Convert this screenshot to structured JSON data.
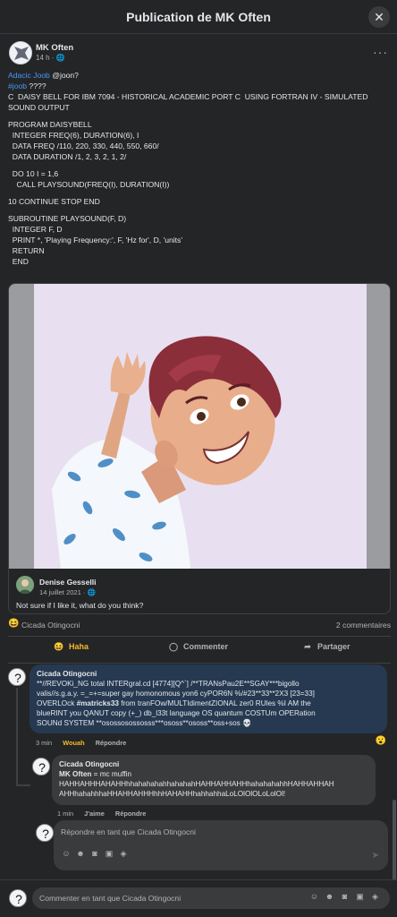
{
  "header": {
    "title": "Publication de MK Often",
    "close_icon": "close-icon"
  },
  "post": {
    "author": "MK Often",
    "time": "14 h ·",
    "lines": [
      {
        "parts": [
          {
            "t": "Adacic Joob",
            "link": true
          },
          {
            "t": " @joon?"
          }
        ]
      },
      {
        "parts": [
          {
            "t": "#joob",
            "link": true
          },
          {
            "t": " ????"
          }
        ]
      },
      {
        "parts": [
          {
            "t": "C  DAISY BELL FOR IBM 7094 - HISTORICAL ACADEMIC PORT C  USING FORTRAN IV - SIMULATED"
          }
        ]
      },
      {
        "parts": [
          {
            "t": "SOUND OUTPUT"
          }
        ]
      },
      {
        "gap": true
      },
      {
        "parts": [
          {
            "t": "PROGRAM DAISYBELL"
          }
        ]
      },
      {
        "parts": [
          {
            "t": "  INTEGER FREQ(6), DURATION(6), I"
          }
        ]
      },
      {
        "parts": [
          {
            "t": "  DATA FREQ /110, 220, 330, 440, 550, 660/"
          }
        ]
      },
      {
        "parts": [
          {
            "t": "  DATA DURATION /1, 2, 3, 2, 1, 2/"
          }
        ]
      },
      {
        "gap": true
      },
      {
        "parts": [
          {
            "t": "  DO 10 I = 1,6"
          }
        ]
      },
      {
        "parts": [
          {
            "t": "    CALL PLAYSOUND(FREQ(I), DURATION(I))"
          }
        ]
      },
      {
        "gap": true
      },
      {
        "parts": [
          {
            "t": "10 CONTINUE STOP END"
          }
        ]
      },
      {
        "gap": true
      },
      {
        "parts": [
          {
            "t": "SUBROUTINE PLAYSOUND(F, D)"
          }
        ]
      },
      {
        "parts": [
          {
            "t": "  INTEGER F, D"
          }
        ]
      },
      {
        "parts": [
          {
            "t": "  PRINT *, 'Playing Frequency:', F, 'Hz for', D, 'units'"
          }
        ]
      },
      {
        "parts": [
          {
            "t": "  RETURN"
          }
        ]
      },
      {
        "parts": [
          {
            "t": "  END"
          }
        ]
      }
    ]
  },
  "shared": {
    "author": "Denise Gesselli",
    "date": "14 juillet 2021 · ",
    "text": "Not sure if I like it, what do you think?"
  },
  "reactions": {
    "emoji": "😆",
    "reactor": "Cicada Otingocni",
    "comments": "2 commentaires"
  },
  "actions": {
    "haha": "Haha",
    "comment": "Commenter",
    "share": "Partager"
  },
  "comments": [
    {
      "author": "Cicada Otingocni",
      "lines": [
        "**//REVOKi_NG total INTERgral.cd [4774][Q^`] /**TRANsPau2E**SGAY***bigollo",
        "valis//s.g.a.y. =_=+=super gay homonomous yon6 cyPOR6N %/#23**33**2X3 [23=33]",
        "OVERLOck ",
        "blueRINT you QANUT copy (+_) db_l33t language OS quantum COSTUm OPERation",
        "SOUNd SYSTEM **osossosossosss***ososs**ososs**oss+sos 💀"
      ],
      "tag": "#matricks33",
      "line3_rest": " from tranFOw/MULTIdimentZIONAL zer0 RUles %I AM the",
      "time": "3 min",
      "reaction": "Wouah",
      "reply": "Répondre",
      "react_emoji": "😮"
    },
    {
      "author": "Cicada Otingocni",
      "mention": "MK Often",
      "line1_rest": " = mc muffin",
      "lines": [
        "HAHHAHHHAHAHHhhahahahahhahahahHAHHAHHAHHhahahahahhHAHHAHHAH",
        "AHHhahahhhaHHAHHAHHHhhHAHAHHhahhahhaLoLOlOlOLoLolOl!"
      ],
      "time": "1 min",
      "like": "J'aime",
      "reply": "Répondre"
    }
  ],
  "reply_box": {
    "placeholder": "Répondre en tant que Cicada Otingocni"
  },
  "composer": {
    "placeholder": "Commenter en tant que Cicada Otingocni"
  }
}
